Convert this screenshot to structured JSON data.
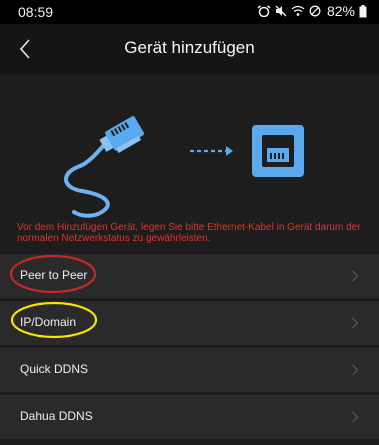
{
  "status_bar": {
    "time": "08:59",
    "battery": "82%"
  },
  "header": {
    "title": "Gerät hinzufügen",
    "back_icon": "chevron-left-icon"
  },
  "notice": "Vor dem Hinzufügen Gerät, legen Sie bitte Ethernet-Kabel in Gerät darum der normalen Netzwerkstatus zu gewährleisten.",
  "menu": {
    "items": [
      {
        "label": "Peer to Peer"
      },
      {
        "label": "IP/Domain"
      },
      {
        "label": "Quick DDNS"
      },
      {
        "label": "Dahua DDNS"
      }
    ]
  },
  "colors": {
    "accent_blue": "#5aa8ee",
    "notice_red": "#e0342c",
    "annotation_red": "#c6282a",
    "annotation_yellow": "#f5e500"
  }
}
